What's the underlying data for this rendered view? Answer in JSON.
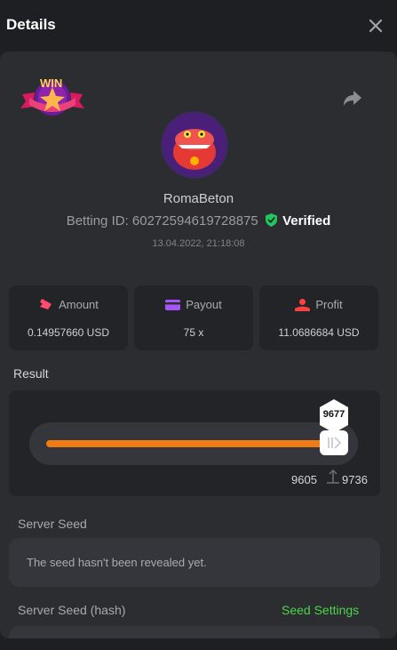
{
  "header": {
    "title": "Details",
    "close_icon": "close-icon"
  },
  "bet": {
    "username": "RomaBeton",
    "betting_id_label": "Betting ID:",
    "betting_id": "60272594619728875",
    "verified_label": "Verified",
    "datetime": "13.04.2022, 21:18:08",
    "badge_text": "WIN"
  },
  "stats": [
    {
      "label": "Amount",
      "value": "0.14957660 USD",
      "icon": "amount-icon",
      "color": "#ff4b6e"
    },
    {
      "label": "Payout",
      "value": "75 x",
      "icon": "payout-icon",
      "color": "#a855f7"
    },
    {
      "label": "Profit",
      "value": "11.0686684 USD",
      "icon": "profit-icon",
      "color": "#ff4040"
    }
  ],
  "result": {
    "label": "Result",
    "value": "9677",
    "min": "9605",
    "max": "9736",
    "accent": "#f07a14"
  },
  "server_seed": {
    "label": "Server Seed",
    "message": "The seed hasn't been revealed yet."
  },
  "server_seed_hash": {
    "label": "Server Seed (hash)",
    "settings_link": "Seed Settings",
    "accent": "#4fd44a"
  }
}
